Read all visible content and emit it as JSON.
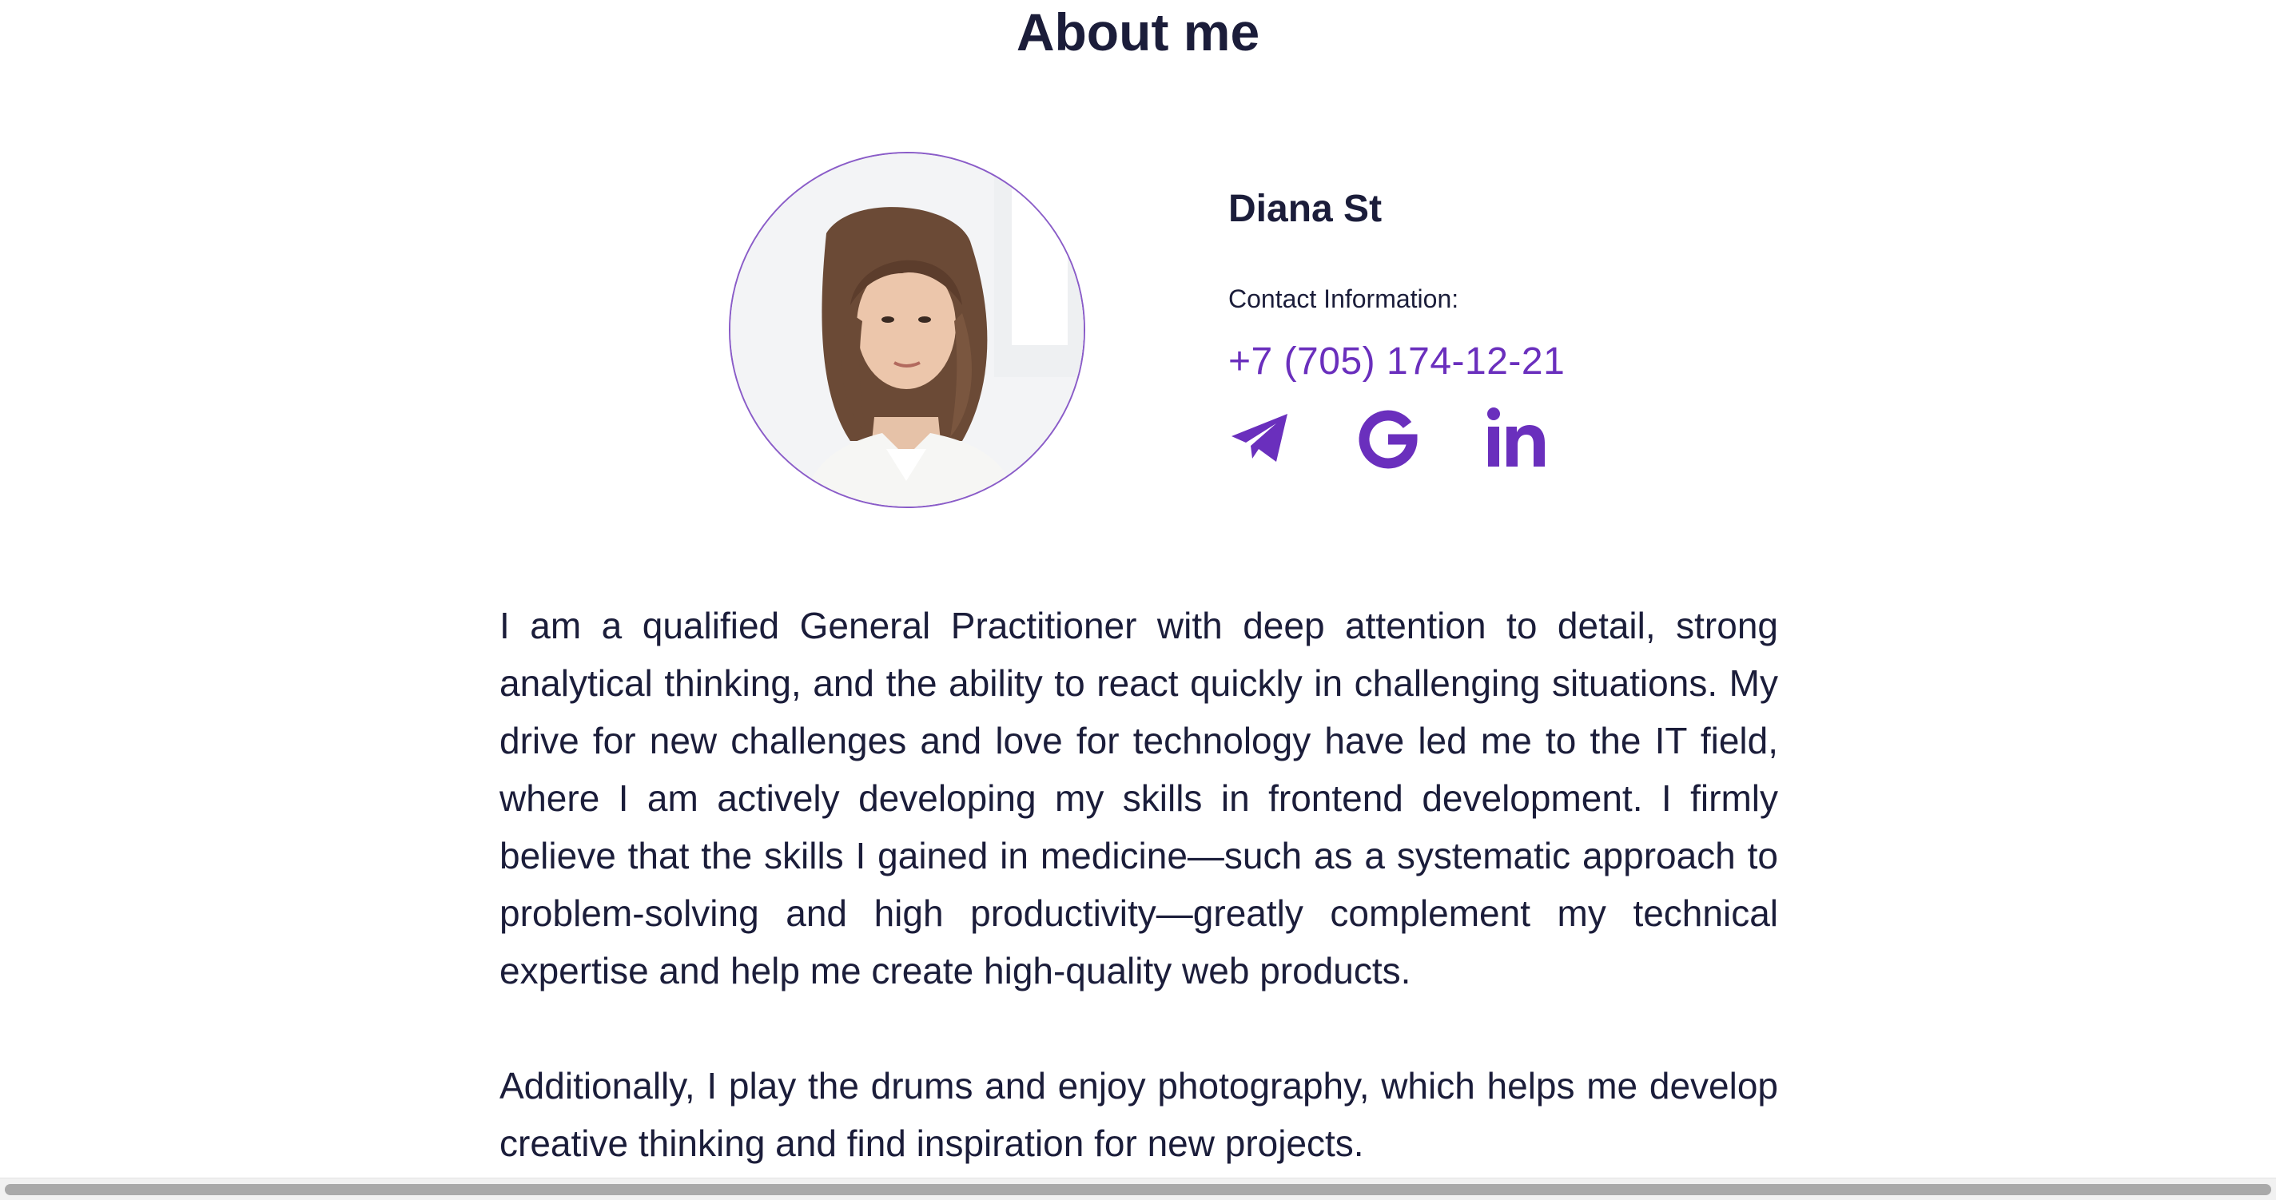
{
  "section": {
    "title": "About me"
  },
  "profile": {
    "name": "Diana St",
    "contact_label": "Contact Information:",
    "phone": "+7 (705) 174-12-21",
    "photo_icon": "portrait-photo"
  },
  "socials": [
    {
      "icon": "telegram-icon"
    },
    {
      "icon": "google-icon"
    },
    {
      "icon": "linkedin-icon"
    }
  ],
  "bio": {
    "paragraphs": [
      "I am a qualified General Practitioner with deep attention to detail, strong analytical thinking, and the ability to react quickly in challenging situations. My drive for new challenges and love for technology have led me to the IT field, where I am actively developing my skills in frontend development. I firmly believe that the skills I gained in medicine—such as a systematic approach to problem-solving and high productivity—greatly complement my technical expertise and help me create high-quality web products.",
      "Additionally, I play the drums and enjoy photography, which helps me develop creative thinking and find inspiration for new projects."
    ]
  },
  "colors": {
    "accent": "#6a2fbd",
    "text": "#1b1d3a",
    "avatar_border": "#8a5cc8"
  }
}
